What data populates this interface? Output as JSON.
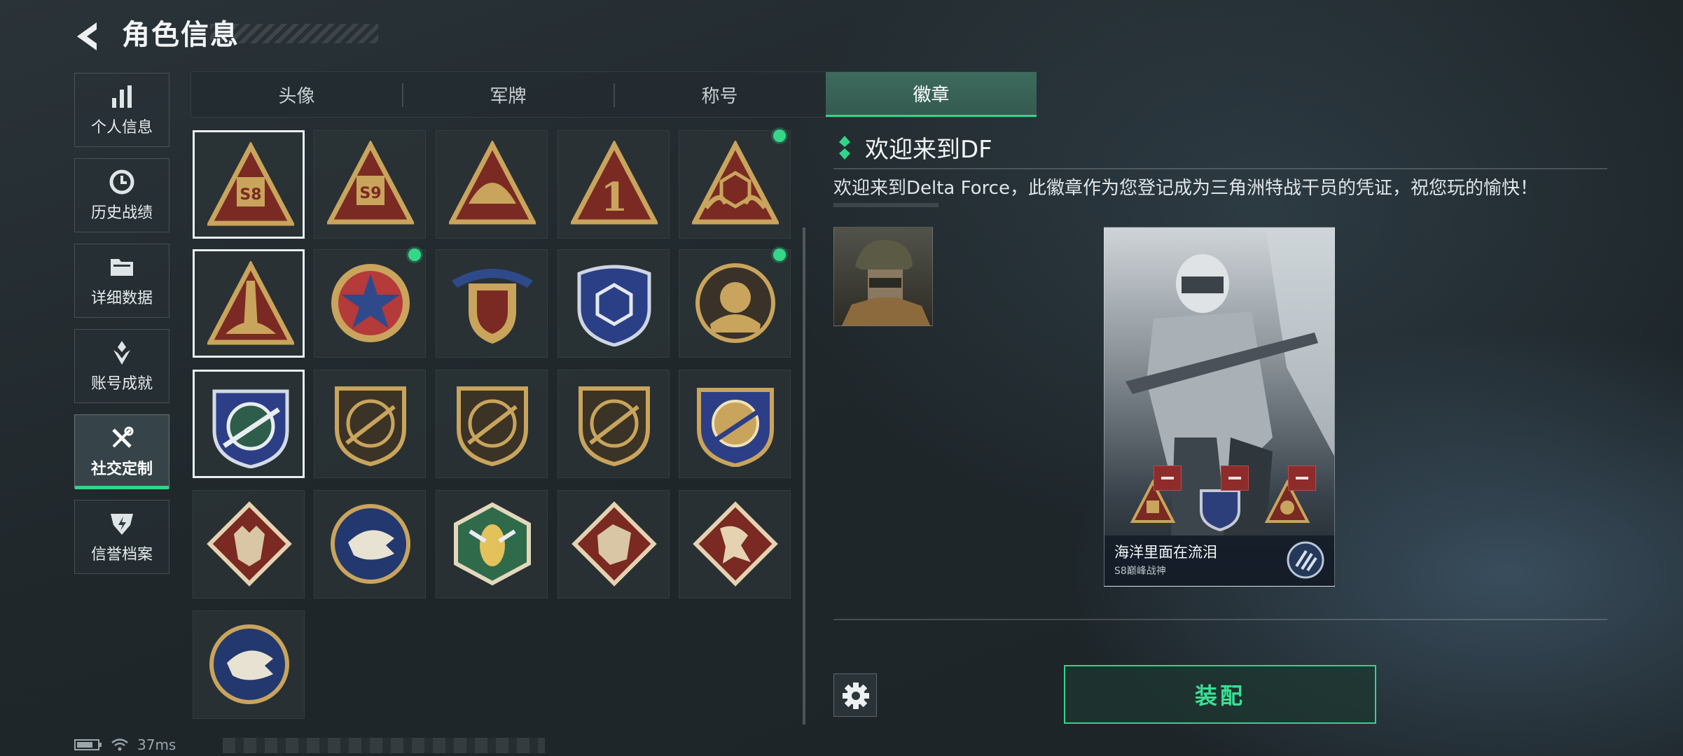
{
  "header": {
    "title": "角色信息",
    "back_icon": "back-arrow-icon"
  },
  "nav": {
    "items": [
      {
        "label": "个人信息",
        "icon": "bar-chart-icon",
        "active": false
      },
      {
        "label": "历史战绩",
        "icon": "history-clock-icon",
        "active": false
      },
      {
        "label": "详细数据",
        "icon": "folder-icon",
        "active": false
      },
      {
        "label": "账号成就",
        "icon": "achievement-icon",
        "active": false
      },
      {
        "label": "社交定制",
        "icon": "wrench-tools-icon",
        "active": true
      },
      {
        "label": "信誉档案",
        "icon": "credit-shield-icon",
        "active": false
      }
    ]
  },
  "tabs": [
    {
      "label": "头像",
      "active": false
    },
    {
      "label": "军牌",
      "active": false
    },
    {
      "label": "称号",
      "active": false
    },
    {
      "label": "徽章",
      "active": true
    }
  ],
  "badges": [
    {
      "name": "s8-triangle-badge",
      "text": "S8",
      "selected": true,
      "new": false
    },
    {
      "name": "s9-triangle-badge",
      "text": "S9",
      "selected": false,
      "new": false
    },
    {
      "name": "bird-triangle-badge",
      "text": "",
      "selected": false,
      "new": false
    },
    {
      "name": "number-one-triangle-badge",
      "text": "1",
      "selected": false,
      "new": false
    },
    {
      "name": "hexagon-hands-triangle-badge",
      "text": "",
      "selected": false,
      "new": true
    },
    {
      "name": "soldiers-triangle-badge",
      "text": "",
      "selected": true,
      "new": false
    },
    {
      "name": "rocket-triangle-badge",
      "text": "",
      "selected": false,
      "new": true
    },
    {
      "name": "star-medallion-badge",
      "text": "",
      "selected": false,
      "new": false
    },
    {
      "name": "winged-shield-badge",
      "text": "",
      "selected": false,
      "new": false
    },
    {
      "name": "blue-hexagon-shield-badge",
      "text": "",
      "selected": false,
      "new": true
    },
    {
      "name": "armor-circle-badge",
      "text": "",
      "selected": true,
      "new": false
    },
    {
      "name": "crosshair-rifle-blue-badge",
      "text": "",
      "selected": false,
      "new": false
    },
    {
      "name": "rifle-shield-badge-1",
      "text": "",
      "selected": false,
      "new": false
    },
    {
      "name": "rifle-shield-badge-2",
      "text": "",
      "selected": false,
      "new": false
    },
    {
      "name": "rifle-shield-badge-3",
      "text": "",
      "selected": false,
      "new": false
    },
    {
      "name": "crosshair-rifle-gold-badge",
      "text": "",
      "selected": false,
      "new": false
    },
    {
      "name": "wolf-diamond-badge",
      "text": "",
      "selected": false,
      "new": false
    },
    {
      "name": "eagle-circle-badge",
      "text": "",
      "selected": false,
      "new": false
    },
    {
      "name": "wasp-hexagon-badge",
      "text": "",
      "selected": false,
      "new": false
    },
    {
      "name": "dragon-diamond-badge",
      "text": "",
      "selected": false,
      "new": false
    },
    {
      "name": "runner-diamond-badge",
      "text": "",
      "selected": false,
      "new": false
    }
  ],
  "detail": {
    "title": "欢迎来到DF",
    "description": "欢迎来到Delta Force，此徽章作为您登记成为三角洲特战干员的凭证，祝您玩的愉快！"
  },
  "card": {
    "player_name": "海洋里面在流泪",
    "rank": "S8巅峰战神"
  },
  "actions": {
    "equip_label": "装配",
    "settings_icon": "gear-icon"
  },
  "status": {
    "ping": "37ms"
  },
  "colors": {
    "accent": "#2fd58a",
    "badge_gold": "#c9a45c",
    "badge_red": "#7a2a22",
    "remove_red": "#8e2b2b"
  }
}
